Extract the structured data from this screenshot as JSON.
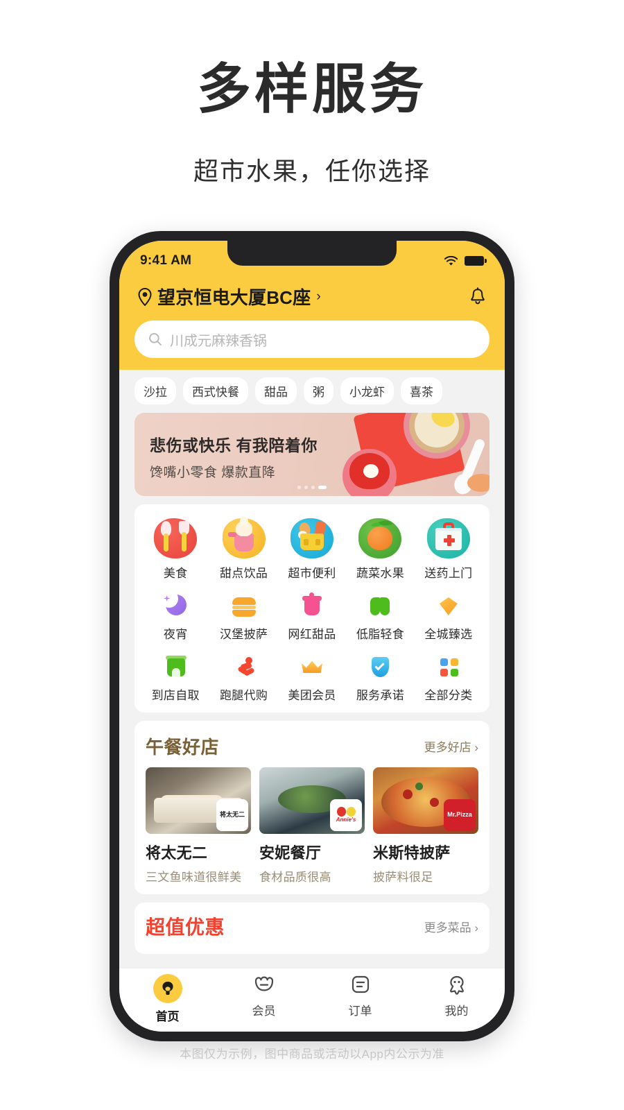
{
  "promo": {
    "title": "多样服务",
    "subtitle": "超市水果，任你选择",
    "footnote": "本图仅为示例，图中商品或活动以App内公示为准"
  },
  "statusbar": {
    "time": "9:41 AM",
    "wifi_icon": "wifi-icon",
    "battery_icon": "battery-icon"
  },
  "header": {
    "location": "望京恒电大厦BC座",
    "location_arrow": "›",
    "pin_icon": "location-pin-icon",
    "bell_icon": "notification-bell-icon"
  },
  "search": {
    "placeholder": "川成元麻辣香锅",
    "icon": "search-icon"
  },
  "chips": [
    "沙拉",
    "西式快餐",
    "甜品",
    "粥",
    "小龙虾",
    "喜茶"
  ],
  "banner": {
    "headline": "悲伤或快乐 有我陪着你",
    "subline": "馋嘴小零食 爆款直降",
    "dots": 4,
    "active_dot": 3
  },
  "grid": {
    "row1": [
      {
        "label": "美食",
        "icon": "cutlery-icon"
      },
      {
        "label": "甜点饮品",
        "icon": "dessert-drink-icon"
      },
      {
        "label": "超市便利",
        "icon": "supermarket-basket-icon"
      },
      {
        "label": "蔬菜水果",
        "icon": "fruit-vegetable-icon"
      },
      {
        "label": "送药上门",
        "icon": "medicine-delivery-icon"
      }
    ],
    "row2": [
      {
        "label": "夜宵",
        "icon": "moon-icon"
      },
      {
        "label": "汉堡披萨",
        "icon": "burger-icon"
      },
      {
        "label": "网红甜品",
        "icon": "dessert-cup-icon"
      },
      {
        "label": "低脂轻食",
        "icon": "sprout-icon"
      },
      {
        "label": "全城臻选",
        "icon": "diamond-icon"
      }
    ],
    "row3": [
      {
        "label": "到店自取",
        "icon": "store-pickup-icon"
      },
      {
        "label": "跑腿代购",
        "icon": "runner-errand-icon"
      },
      {
        "label": "美团会员",
        "icon": "crown-membership-icon"
      },
      {
        "label": "服务承诺",
        "icon": "shield-check-icon"
      },
      {
        "label": "全部分类",
        "icon": "all-categories-grid-icon"
      }
    ]
  },
  "lunch": {
    "title": "午餐好店",
    "more": "更多好店 ›",
    "shops": [
      {
        "name": "将太无二",
        "desc": "三文鱼味道很鲜美",
        "brand": "将太无二"
      },
      {
        "name": "安妮餐厅",
        "desc": "食材品质很高",
        "brand": "Annie's"
      },
      {
        "name": "米斯特披萨",
        "desc": "披萨料很足",
        "brand": "Mr.Pizza"
      }
    ]
  },
  "deals": {
    "title": "超值优惠",
    "more": "更多菜品 ›",
    "accent_color": "#f5412e"
  },
  "tabs": [
    {
      "label": "首页",
      "icon": "home-kangaroo-icon",
      "active": true
    },
    {
      "label": "会员",
      "icon": "membership-crown-icon",
      "active": false
    },
    {
      "label": "订单",
      "icon": "orders-list-icon",
      "active": false
    },
    {
      "label": "我的",
      "icon": "profile-kangaroo-icon",
      "active": false
    }
  ],
  "colors": {
    "brand_yellow": "#fbcc3f",
    "deal_red": "#f5412e",
    "section_brown": "#7a6036"
  }
}
